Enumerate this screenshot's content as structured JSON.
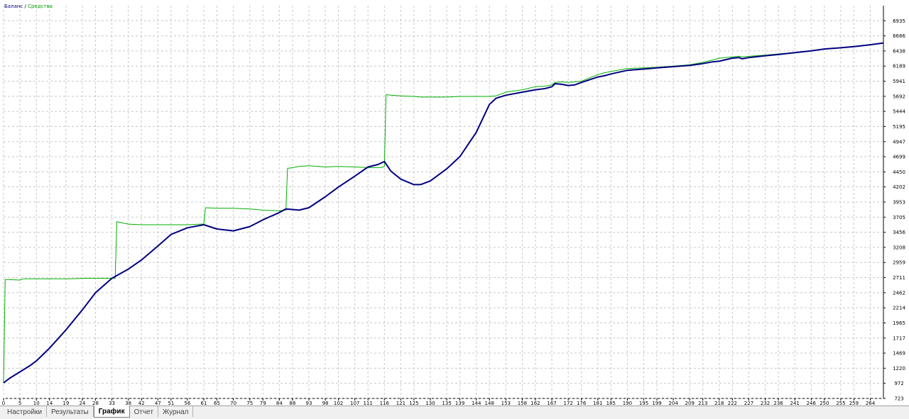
{
  "legend": {
    "balance_label": "Баланс",
    "separator": " / ",
    "equity_label": "Средства",
    "balance_color": "#000080",
    "equity_color": "#00b000"
  },
  "tabs": [
    {
      "label": "Настройки",
      "active": false
    },
    {
      "label": "Результаты",
      "active": false
    },
    {
      "label": "График",
      "active": true
    },
    {
      "label": "Отчет",
      "active": false
    },
    {
      "label": "Журнал",
      "active": false
    }
  ],
  "chart_data": {
    "type": "line",
    "grid": true,
    "legend_position": "top-left",
    "y_axis_side": "right",
    "xlim": [
      0,
      268
    ],
    "ylim": [
      723,
      7183
    ],
    "x_ticks": [
      0,
      5,
      10,
      14,
      19,
      24,
      28,
      33,
      38,
      42,
      47,
      51,
      56,
      61,
      65,
      70,
      75,
      79,
      84,
      88,
      93,
      98,
      102,
      107,
      111,
      116,
      121,
      125,
      130,
      135,
      139,
      144,
      148,
      153,
      158,
      162,
      167,
      172,
      176,
      181,
      185,
      190,
      195,
      199,
      204,
      209,
      213,
      218,
      222,
      227,
      232,
      236,
      241,
      246,
      250,
      255,
      259,
      264
    ],
    "y_ticks": [
      723,
      972,
      1220,
      1469,
      1717,
      1965,
      2214,
      2462,
      2711,
      2959,
      3208,
      3456,
      3705,
      3953,
      4202,
      4450,
      4699,
      4947,
      5195,
      5444,
      5692,
      5941,
      6189,
      6438,
      6686,
      6935
    ],
    "series": [
      {
        "name": "Баланс",
        "color": "#000080",
        "x": [
          0,
          2,
          5,
          8,
          10,
          14,
          19,
          24,
          28,
          33,
          38,
          42,
          47,
          51,
          56,
          61,
          65,
          70,
          75,
          79,
          84,
          86,
          88,
          90,
          93,
          98,
          102,
          107,
          111,
          114,
          116,
          118,
          121,
          125,
          127,
          130,
          135,
          139,
          144,
          148,
          150,
          153,
          158,
          162,
          165,
          167,
          168,
          170,
          172,
          174,
          176,
          181,
          183,
          185,
          190,
          195,
          199,
          204,
          209,
          213,
          216,
          218,
          222,
          224,
          225,
          227,
          232,
          236,
          241,
          246,
          250,
          255,
          259,
          264,
          268
        ],
        "y": [
          980,
          1060,
          1160,
          1260,
          1340,
          1550,
          1850,
          2180,
          2460,
          2700,
          2850,
          3000,
          3230,
          3420,
          3530,
          3580,
          3510,
          3480,
          3550,
          3660,
          3780,
          3840,
          3830,
          3820,
          3860,
          4040,
          4200,
          4380,
          4530,
          4570,
          4620,
          4460,
          4330,
          4240,
          4240,
          4300,
          4500,
          4700,
          5100,
          5560,
          5660,
          5710,
          5760,
          5800,
          5820,
          5850,
          5900,
          5890,
          5870,
          5880,
          5920,
          6010,
          6030,
          6060,
          6120,
          6140,
          6160,
          6180,
          6200,
          6230,
          6260,
          6270,
          6320,
          6330,
          6310,
          6330,
          6360,
          6380,
          6410,
          6440,
          6470,
          6490,
          6510,
          6540,
          6570
        ]
      },
      {
        "name": "Средства",
        "color": "#00b000",
        "x": [
          0,
          0.5,
          1,
          5,
          6,
          10,
          15,
          20,
          25,
          30,
          34,
          34.5,
          38,
          42,
          47,
          51,
          56,
          60,
          61,
          61.5,
          65,
          70,
          75,
          79,
          84,
          86,
          86.5,
          87,
          90,
          93,
          98,
          102,
          107,
          111,
          115,
          116,
          116.5,
          118,
          121,
          125,
          127,
          130,
          135,
          139,
          144,
          148,
          150,
          153,
          158,
          162,
          165,
          167,
          168,
          170,
          172,
          174,
          176,
          181,
          183,
          185,
          190,
          195,
          199,
          204,
          209,
          213,
          216,
          218,
          222,
          224,
          225,
          227,
          232,
          236,
          241,
          246,
          250,
          255,
          259,
          264,
          268
        ],
        "y": [
          980,
          2680,
          2680,
          2670,
          2690,
          2690,
          2690,
          2690,
          2700,
          2700,
          2700,
          3630,
          3590,
          3580,
          3580,
          3580,
          3580,
          3590,
          3590,
          3860,
          3850,
          3850,
          3840,
          3820,
          3810,
          3820,
          4510,
          4510,
          4540,
          4550,
          4530,
          4540,
          4530,
          4520,
          4520,
          4540,
          5720,
          5710,
          5700,
          5690,
          5680,
          5680,
          5680,
          5690,
          5690,
          5690,
          5700,
          5760,
          5800,
          5850,
          5860,
          5880,
          5920,
          5930,
          5920,
          5930,
          5940,
          6050,
          6080,
          6100,
          6150,
          6160,
          6170,
          6190,
          6210,
          6250,
          6290,
          6320,
          6340,
          6350,
          6340,
          6350,
          6370,
          6390,
          6410,
          6440,
          6470,
          6490,
          6510,
          6540,
          6570
        ]
      }
    ]
  }
}
